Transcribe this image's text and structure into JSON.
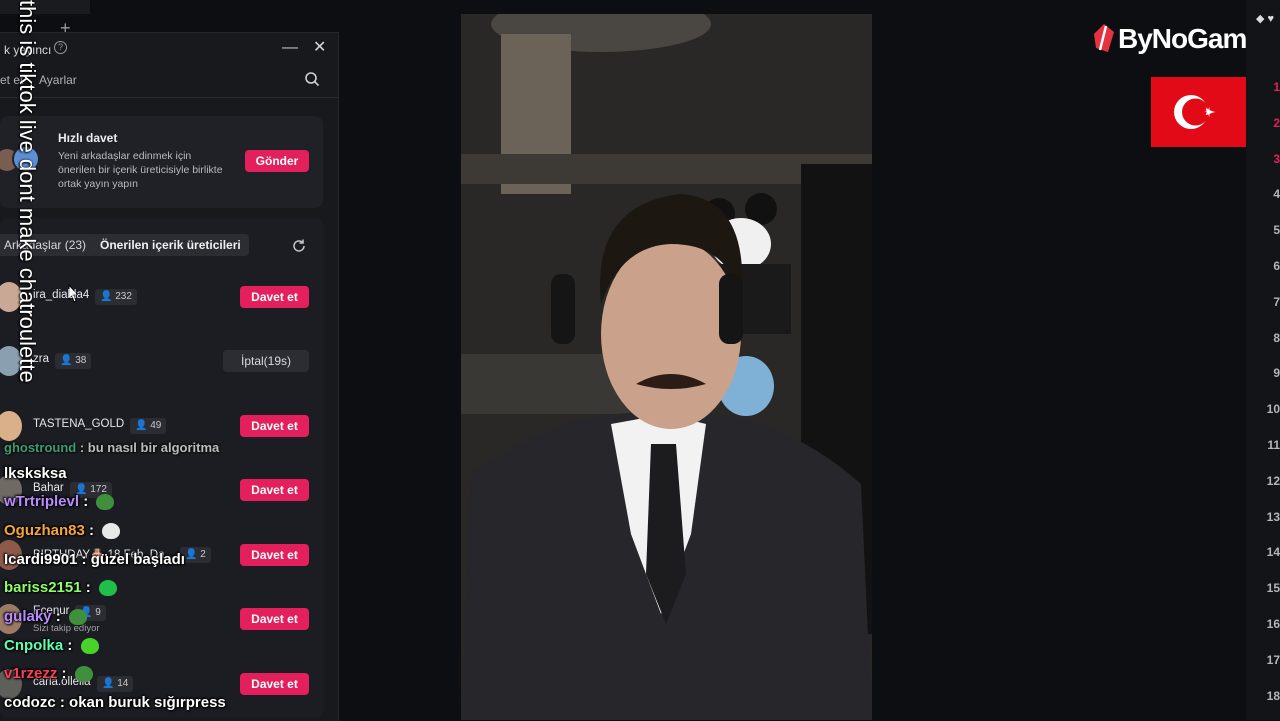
{
  "overlay_text": "this is tiktok live dont make chatroulette",
  "panel": {
    "title": "k yayıncı",
    "help_glyph": "?",
    "tabs": [
      "et et",
      "Ayarlar"
    ],
    "quick_invite": {
      "title": "Hızlı davet",
      "description": "Yeni arkadaşlar edinmek için önerilen bir içerik üreticisiyle birlikte ortak yayın yapın",
      "button": "Gönder"
    },
    "filters": {
      "friends": "Arkadaşlar (23)",
      "suggested": "Önerilen içerik üreticileri"
    },
    "rows": [
      {
        "name": "ira_diabla4",
        "count": "232",
        "action": "Davet et",
        "avatar_color": "#c9a896"
      },
      {
        "name": "zra",
        "count": "38",
        "action": "İptal(19s)",
        "avatar_color": "#8aa0b0"
      },
      {
        "name": "TASTENA_GOLD",
        "count": "49",
        "action": "Davet et",
        "avatar_color": "#d9b08a"
      },
      {
        "name": "Bahar",
        "count": "172",
        "action": "Davet et",
        "avatar_color": "#6f6a64"
      },
      {
        "name": "BIRTHDAY🎂 18 Feb. Da...",
        "count": "2",
        "action": "Davet et",
        "avatar_color": "#8d5a4a"
      },
      {
        "name": "Ecenur",
        "count": "9",
        "subtitle": "Sizi takip ediyor",
        "action": "Davet et",
        "avatar_color": "#9b7b66"
      },
      {
        "name": "carla.ollella",
        "count": "14",
        "action": "Davet et",
        "avatar_color": "#5e5e5a"
      }
    ]
  },
  "chat": [
    {
      "user": "ghostround",
      "message": "bu nasıl bir algoritma",
      "color": "#4bd18f"
    },
    {
      "user": "",
      "message": "lksksksa",
      "color": "#ffffff"
    },
    {
      "user": "wTrtriplevl",
      "message": "",
      "color": "#b88cff",
      "emote": "#3f8f3c"
    },
    {
      "user": "Oguzhan83",
      "message": "",
      "color": "#f6a53b",
      "emote": "#e8e8e8"
    },
    {
      "user": "Icardi9901",
      "message": "güzel başladı",
      "color": "#ffffff"
    },
    {
      "user": "bariss2151",
      "message": "",
      "color": "#8dff6a",
      "emote": "#1fbf4a"
    },
    {
      "user": "gulaky",
      "message": "",
      "color": "#b88cff",
      "emote": "#3f8f3c"
    },
    {
      "user": "Cnpolka",
      "message": "",
      "color": "#5fffb0",
      "emote": "#49d22c"
    },
    {
      "user": "v1rzezz",
      "message": "",
      "color": "#ff3e58",
      "emote": "#3f8f3c"
    },
    {
      "user": "codozc",
      "message": "okan buruk sığırpress",
      "color": "#ffffff"
    }
  ],
  "brand": {
    "name": "ByNoGame"
  },
  "leaderboard": {
    "ranks": [
      "1",
      "2",
      "3",
      "4",
      "5",
      "6",
      "7",
      "8",
      "9",
      "10",
      "11",
      "12",
      "13",
      "14",
      "15",
      "16",
      "17",
      "18"
    ]
  },
  "colors": {
    "accent": "#e4205c",
    "panel_bg": "#18191d",
    "flag_red": "#e30a17"
  }
}
